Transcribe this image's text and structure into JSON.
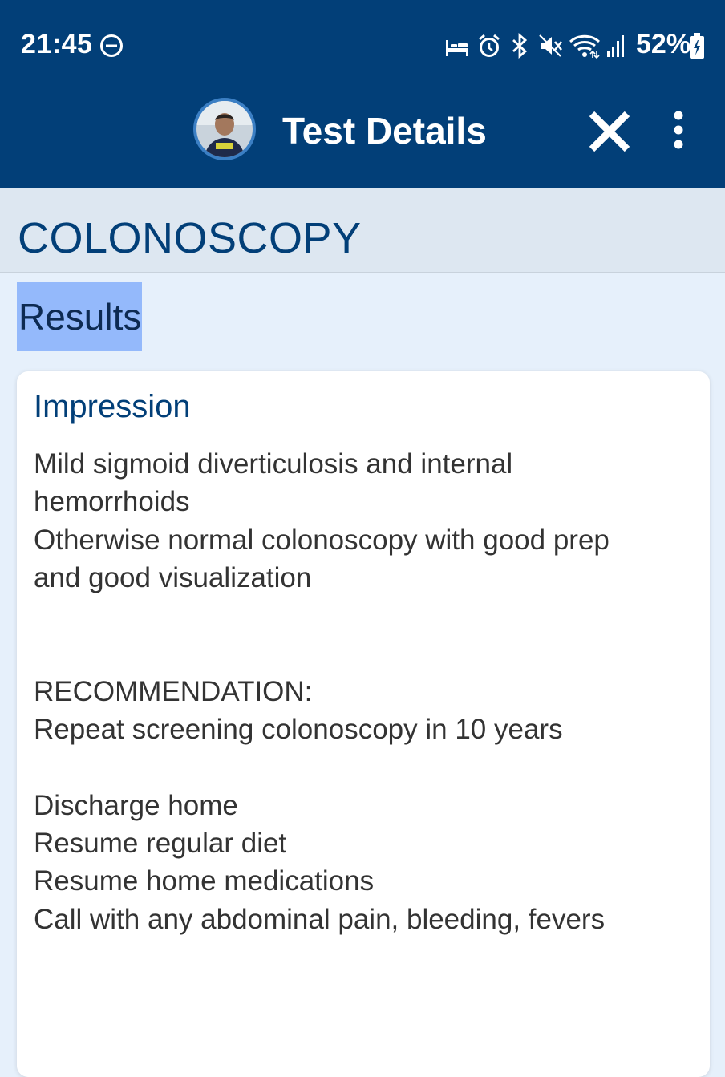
{
  "status_bar": {
    "time": "21:45",
    "battery": "52%",
    "icons": [
      "do-not-disturb-icon",
      "sleep-mode-icon",
      "alarm-icon",
      "bluetooth-icon",
      "mute-icon",
      "wifi-icon",
      "signal-icon",
      "battery-charging-icon"
    ]
  },
  "app_bar": {
    "title": "Test Details",
    "background": "#023f78"
  },
  "test": {
    "name": "COLONOSCOPY",
    "section_label": "Results"
  },
  "result_card": {
    "heading": "Impression",
    "text": "Mild sigmoid diverticulosis and internal\nhemorrhoids\nOtherwise normal colonoscopy with good prep\nand good visualization\n\n\nRECOMMENDATION:\nRepeat screening colonoscopy in 10 years\n\nDischarge home\nResume regular diet\nResume home medications\nCall with any abdominal pain, bleeding, fevers"
  },
  "colors": {
    "accent": "#023f78",
    "highlight": "#94b9fb",
    "header_bg": "#dde7f1",
    "page_bg": "#e6f0fb"
  }
}
